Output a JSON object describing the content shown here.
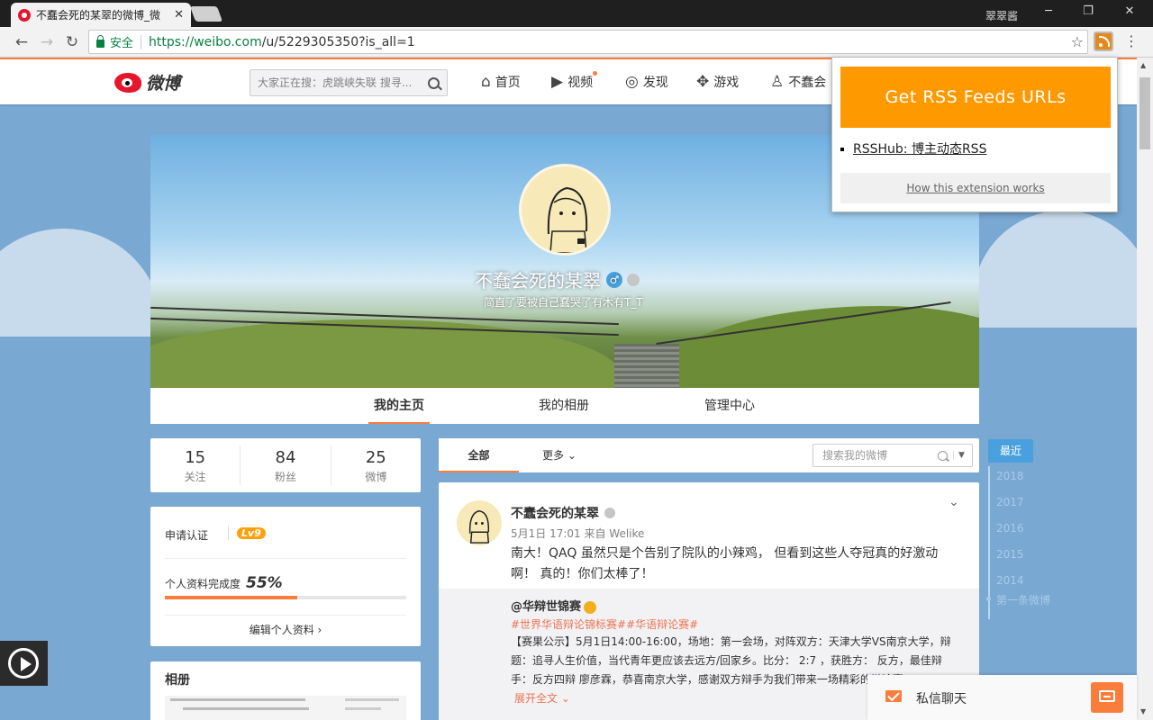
{
  "browser": {
    "tab_title": "不蠢会死的某翠的微博_微",
    "user_name": "翠翠酱",
    "secure_label": "安全",
    "url_host": "https://weibo.com",
    "url_path": "/u/5229305350?is_all=1"
  },
  "topbar": {
    "logo_text": "微博",
    "search_placeholder": "大家正在搜：虎跳峡失联 搜寻...",
    "nav": {
      "home": "首页",
      "video": "视频",
      "discover": "发现",
      "games": "游戏",
      "profile": "不蠢会"
    }
  },
  "profile": {
    "name": "不蠢会死的某翠",
    "gender_symbol": "♂",
    "description": "简直了要被自己蠢哭了有木有T_T",
    "tabs": [
      "我的主页",
      "我的相册",
      "管理中心"
    ]
  },
  "counts": [
    {
      "num": "15",
      "label": "关注"
    },
    {
      "num": "84",
      "label": "粉丝"
    },
    {
      "num": "25",
      "label": "微博"
    }
  ],
  "level_card": {
    "apply": "申请认证",
    "level": "Lv9",
    "complete_label": "个人资料完成度",
    "complete_pct": "55%",
    "complete_value": 0.55,
    "edit_link": "编辑个人资料 ›"
  },
  "album": {
    "title": "相册"
  },
  "feed": {
    "tabs": [
      "全部",
      "更多 ⌄"
    ],
    "search_placeholder": "搜索我的微博"
  },
  "post": {
    "author": "不蠢会死的某翠",
    "meta": "5月1日 17:01 来自 Welike",
    "text": "南大！QAQ 虽然只是个告别了院队的小辣鸡， 但看到这些人夺冠真的好激动啊！ 真的！你们太棒了！",
    "repost": {
      "author": "@华辩世锦赛",
      "tags": "#世界华语辩论锦标赛##华语辩论赛#",
      "text": "【赛果公示】5月1日14:00-16:00，场地：第一会场，对阵双方：天津大学VS南京大学，辩题：追寻人生价值，当代青年更应该去远方/回家乡。比分： 2:7 ，获胜方： 反方，最佳辩手：反方四辩 廖彦霖，恭喜南京大学，感谢双方辩手为我们带来一场精彩的辩论赛",
      "expand": "展开全文 ⌄"
    }
  },
  "timeline": {
    "recent": "最近",
    "years": [
      "2018",
      "2017",
      "2016",
      "2015",
      "2014"
    ],
    "first": "第一条微博"
  },
  "chat": {
    "label": "私信聊天"
  },
  "popup": {
    "header": "Get RSS Feeds URLs",
    "link": "RSSHub: 博主动态RSS",
    "footer": "How this extension works",
    "accent": "#ff9900"
  },
  "colors": {
    "weibo_orange": "#fa7d3c",
    "page_bg": "#79a8d3",
    "secure_green": "#0b8043"
  }
}
